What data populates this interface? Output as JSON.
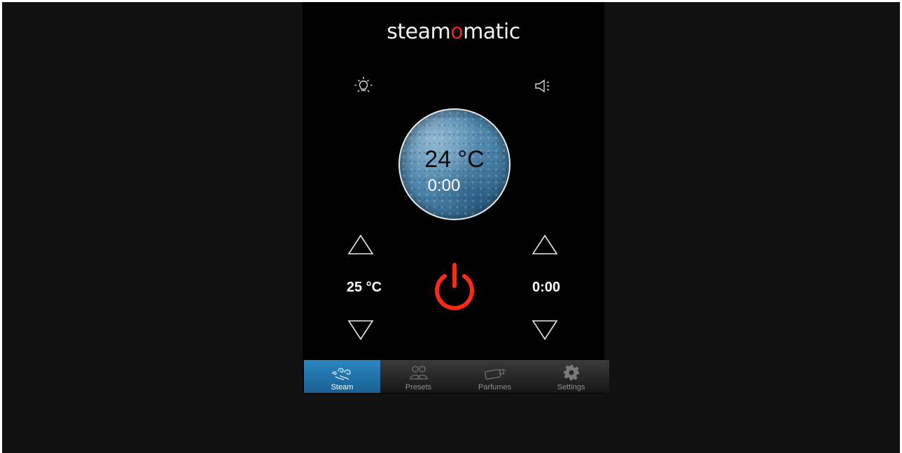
{
  "brand": {
    "prefix": "steam",
    "accent": "o",
    "suffix": "matic",
    "accent_color": "#e8271b"
  },
  "top_icons": {
    "left": "light-bulb-icon",
    "right": "speaker-icon"
  },
  "dial": {
    "current_temperature": "24 °C",
    "elapsed_time": "0:00"
  },
  "temperature_setting": {
    "value": "25 °C",
    "increase_icon": "triangle-up-icon",
    "decrease_icon": "triangle-down-icon"
  },
  "time_setting": {
    "value": "0:00",
    "increase_icon": "triangle-up-icon",
    "decrease_icon": "triangle-down-icon"
  },
  "power": {
    "icon": "power-icon",
    "color": "#ff2a14"
  },
  "tabs": [
    {
      "label": "Steam",
      "icon": "steam-swirl-icon",
      "active": true
    },
    {
      "label": "Presets",
      "icon": "people-icon",
      "active": false
    },
    {
      "label": "Parfumes",
      "icon": "perfume-bottle-icon",
      "active": false
    },
    {
      "label": "Settings",
      "icon": "gear-icon",
      "active": false
    }
  ],
  "colors": {
    "active_tab": "#2a87c2",
    "background": "#000000"
  }
}
